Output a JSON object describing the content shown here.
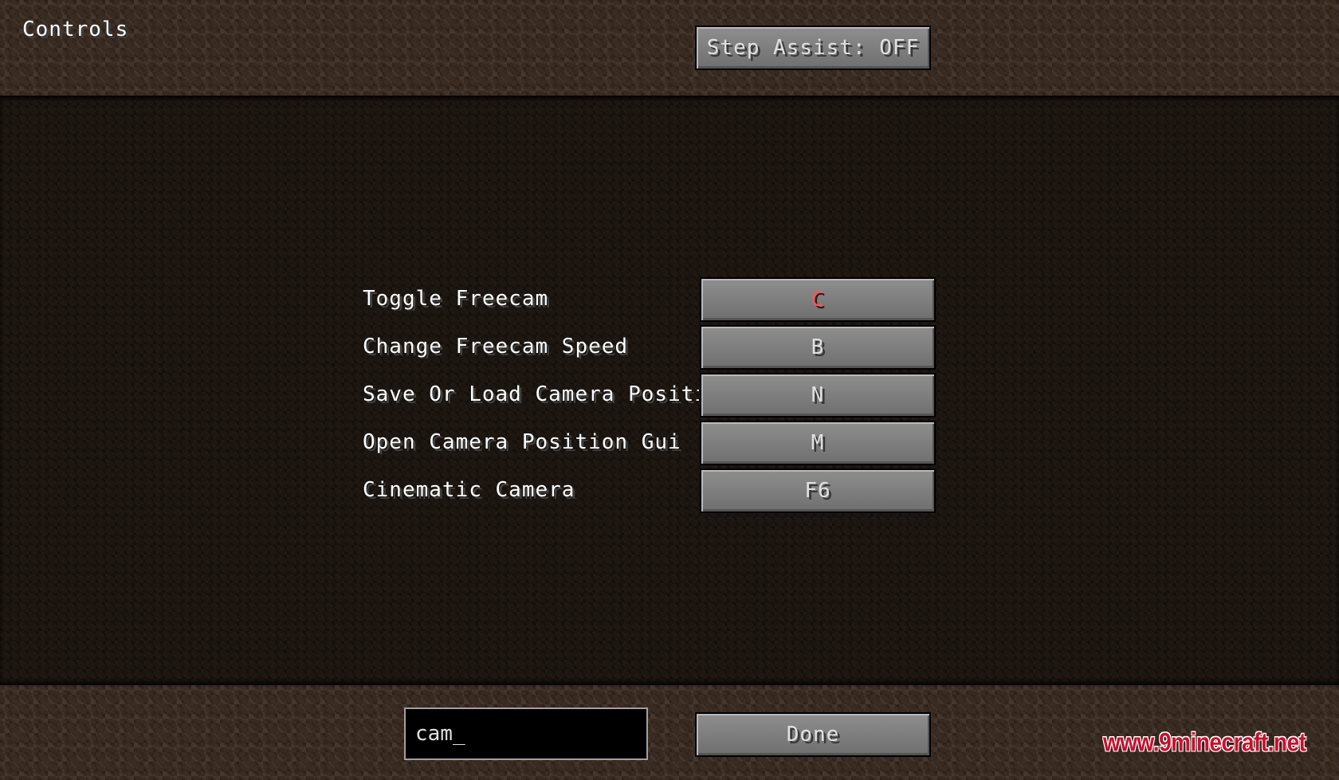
{
  "screen": {
    "title": "Controls"
  },
  "header": {
    "step_assist_label": "Step Assist: OFF"
  },
  "keybinds": [
    {
      "label": "Toggle Freecam",
      "key": "C",
      "conflict": true
    },
    {
      "label": "Change Freecam Speed",
      "key": "B",
      "conflict": false
    },
    {
      "label": "Save Or Load Camera Positio",
      "key": "N",
      "conflict": false
    },
    {
      "label": "Open Camera Position Gui",
      "key": "M",
      "conflict": false
    },
    {
      "label": "Cinematic Camera",
      "key": "F6",
      "conflict": false
    }
  ],
  "footer": {
    "search_value": "cam_",
    "done_label": "Done"
  },
  "watermark": {
    "text": "www.9minecraft.net"
  },
  "colors": {
    "conflict_key": "#ff5555",
    "normal_key": "#e0e0e0",
    "watermark": "#c8102e"
  }
}
